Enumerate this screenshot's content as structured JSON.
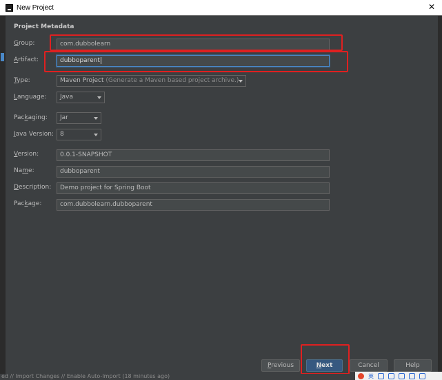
{
  "window": {
    "title": "New Project",
    "close_glyph": "✕"
  },
  "section_title": "Project Metadata",
  "fields": {
    "group": {
      "label": "Group:",
      "mnemonic": "G",
      "rest": "roup:",
      "value": "com.dubbolearn"
    },
    "artifact": {
      "label": "Artifact:",
      "mnemonic": "A",
      "rest": "rtifact:",
      "value": "dubboparent"
    },
    "type": {
      "label": "Type:",
      "mnemonic": "T",
      "rest": "ype:",
      "value": "Maven Project",
      "hint": "(Generate a Maven based project archive.)"
    },
    "language": {
      "label": "Language:",
      "mnemonic": "L",
      "rest": "anguage:",
      "value": "Java"
    },
    "packaging": {
      "label": "Packaging:",
      "pre": "Pac",
      "mnemonic": "k",
      "rest": "aging:",
      "value": "Jar"
    },
    "java_version": {
      "label": "Java Version:",
      "mnemonic": "J",
      "rest": "ava Version:",
      "value": "8"
    },
    "version": {
      "label": "Version:",
      "mnemonic": "V",
      "rest": "ersion:",
      "value": "0.0.1-SNAPSHOT"
    },
    "name": {
      "label": "Name:",
      "pre": "Na",
      "mnemonic": "m",
      "rest": "e:",
      "value": "dubboparent"
    },
    "description": {
      "label": "Description:",
      "mnemonic": "D",
      "rest": "escription:",
      "value": "Demo project for Spring Boot"
    },
    "package": {
      "label": "Package:",
      "pre": "Pac",
      "mnemonic": "k",
      "rest": "age:",
      "value": "com.dubbolearn.dubboparent"
    }
  },
  "buttons": {
    "previous": {
      "mnemonic": "P",
      "rest": "revious"
    },
    "next": {
      "mnemonic": "N",
      "rest": "ext"
    },
    "cancel": {
      "label": "Cancel"
    },
    "help": {
      "label": "Help"
    }
  },
  "status": {
    "text": "ed // Import Changes // Enable Auto-Import (18 minutes ago)"
  },
  "tray": {
    "char": "英"
  },
  "colors": {
    "annotation": "#e02020",
    "primary_button": "#365880",
    "focus": "#4a88c7"
  }
}
